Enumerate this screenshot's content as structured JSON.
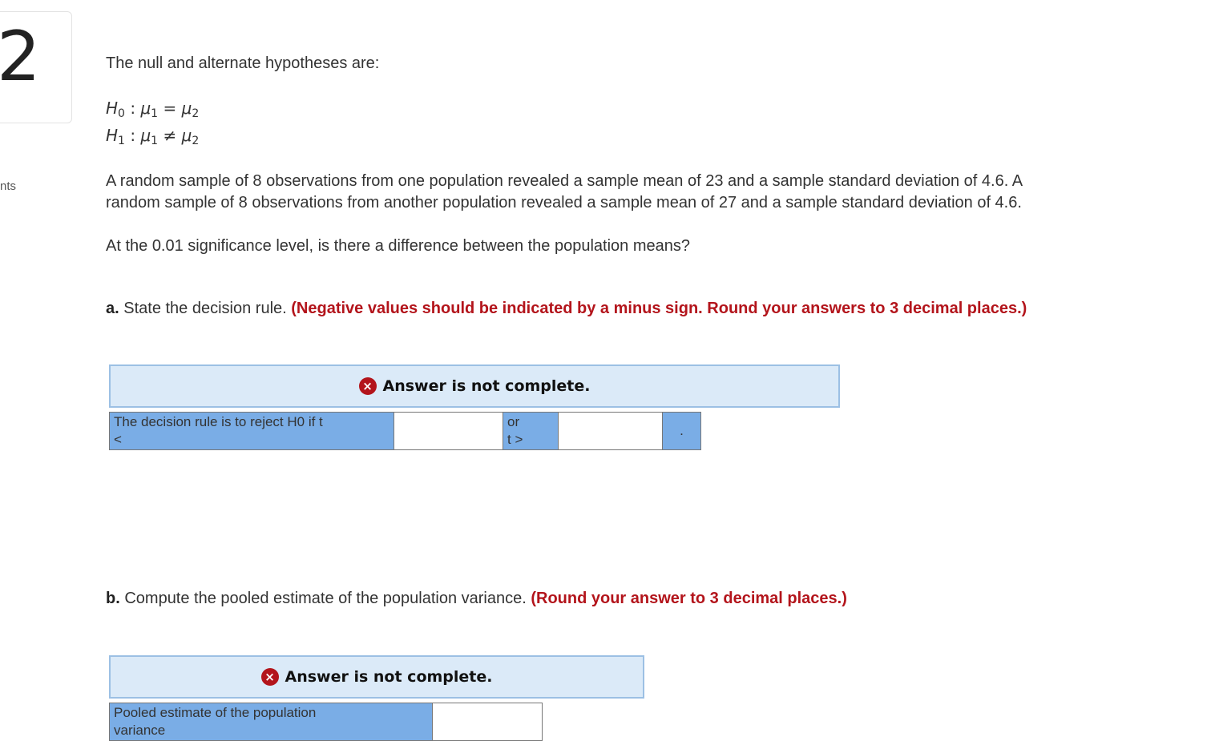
{
  "question": {
    "number": "2",
    "points_label": "nts"
  },
  "intro": "The null and alternate hypotheses are:",
  "hypotheses": {
    "h0": {
      "lhs": "H",
      "lhs_sub": "0",
      "mu1": "μ",
      "mu1_sub": "1",
      "op": "=",
      "mu2": "μ",
      "mu2_sub": "2"
    },
    "h1": {
      "lhs": "H",
      "lhs_sub": "1",
      "mu1": "μ",
      "mu1_sub": "1",
      "op": "≠",
      "mu2": "μ",
      "mu2_sub": "2"
    }
  },
  "problem_line1": "A random sample of 8 observations from one population revealed a sample mean of 23 and a sample standard deviation of 4.6. A",
  "problem_line2": "random sample of 8 observations from another population revealed a sample mean of 27 and a sample standard deviation of 4.6.",
  "significance_question": "At the 0.01 significance level, is there a difference between the population means?",
  "part_a": {
    "label": "a.",
    "prompt": " State the decision rule. ",
    "instruction": "(Negative values should be indicated by a minus sign. Round your answers to 3 decimal places.)",
    "banner_icon": "x-circle-icon",
    "banner": "Answer is not complete.",
    "rule_label_line1": "The decision rule is to reject H0 if t",
    "rule_label_line2": "<",
    "lower_value": "",
    "or_line1": "or",
    "or_line2": "t >",
    "upper_value": "",
    "end_mark": "."
  },
  "part_b": {
    "label": "b.",
    "prompt": " Compute the pooled estimate of the population variance. ",
    "instruction": "(Round your answer to 3 decimal places.)",
    "banner_icon": "x-circle-icon",
    "banner": "Answer is not complete.",
    "field_label": "Pooled estimate of the population variance",
    "value": ""
  },
  "colors": {
    "accent_red": "#b3141b",
    "banner_bg": "#dbeaf8",
    "label_cell_bg": "#7aade6"
  }
}
